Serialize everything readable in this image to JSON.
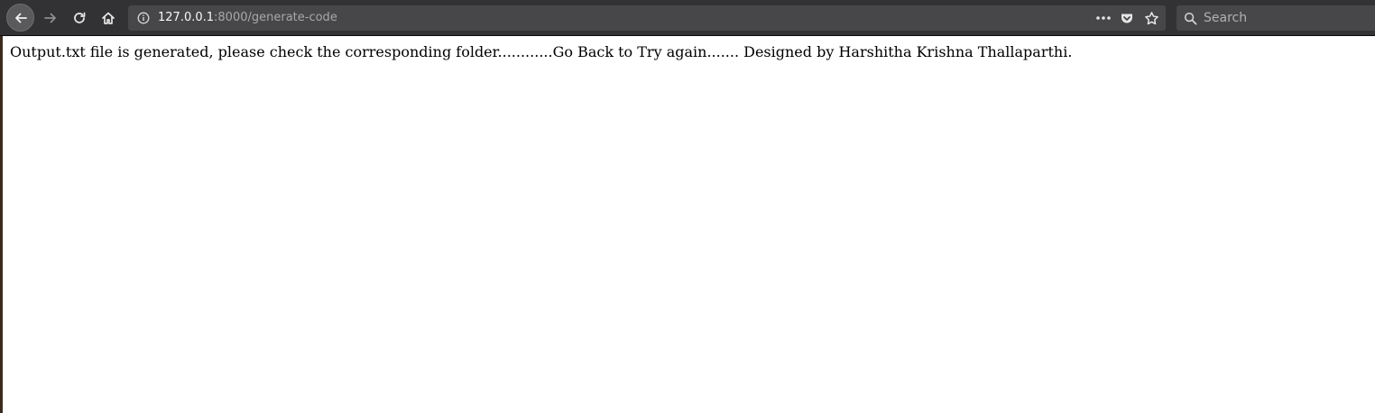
{
  "browser": {
    "url_host": "127.0.0.1",
    "url_path": ":8000/generate-code",
    "search_placeholder": "Search",
    "icons": {
      "back": "arrow-left-icon",
      "forward": "arrow-right-icon",
      "reload": "reload-icon",
      "home": "home-icon",
      "site_info": "info-circle-icon",
      "page_actions": "ellipsis-icon",
      "pocket": "pocket-icon",
      "bookmark": "star-icon",
      "search": "magnifier-icon"
    },
    "colors": {
      "toolbar": "#323234",
      "urlbar": "#474749"
    }
  },
  "page": {
    "message": "Output.txt file is generated, please check the corresponding folder............Go Back to Try again....... Designed by Harshitha Krishna Thallaparthi."
  }
}
